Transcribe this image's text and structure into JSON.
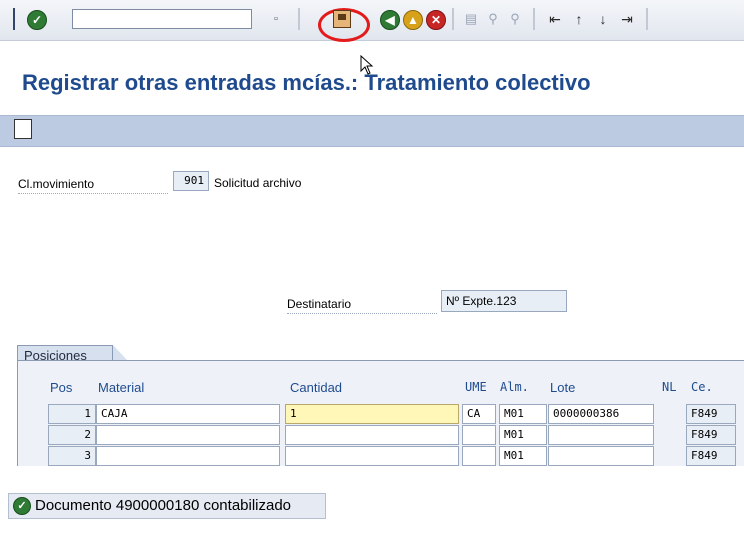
{
  "window": {
    "title": "Registrar otras entradas mcías.: Tratamiento colectivo"
  },
  "toolbar": {
    "command_field_value": "",
    "icons": [
      "enter-icon",
      "save-icon",
      "back-icon",
      "exit-icon",
      "cancel-icon",
      "print-icon",
      "find-icon",
      "find-next-icon",
      "first-page-icon",
      "previous-page-icon",
      "next-page-icon",
      "last-page-icon"
    ]
  },
  "form": {
    "movement_type_label": "Cl.movimiento",
    "movement_type_value": "901",
    "movement_type_text": "Solicitud archivo",
    "recipient_label": "Destinatario",
    "recipient_value": "Nº Expte.123"
  },
  "positions": {
    "tab_label": "Posiciones",
    "columns": [
      "Pos",
      "Material",
      "Cantidad",
      "UME",
      "Alm.",
      "Lote",
      "NL",
      "Ce."
    ],
    "rows": [
      {
        "pos": "1",
        "material": "CAJA",
        "quantity": "1",
        "unit": "CA",
        "storage": "M01",
        "batch": "0000000386",
        "nl": "",
        "plant": "F849"
      },
      {
        "pos": "2",
        "material": "",
        "quantity": "",
        "unit": "",
        "storage": "M01",
        "batch": "",
        "nl": "",
        "plant": "F849"
      },
      {
        "pos": "3",
        "material": "",
        "quantity": "",
        "unit": "",
        "storage": "M01",
        "batch": "",
        "nl": "",
        "plant": "F849"
      }
    ]
  },
  "status": {
    "message": "Documento 4900000180 contabilizado"
  },
  "colors": {
    "title": "#1f4b8e",
    "highlight_circle": "#e31b1b",
    "status_ok": "#2f7a34"
  }
}
